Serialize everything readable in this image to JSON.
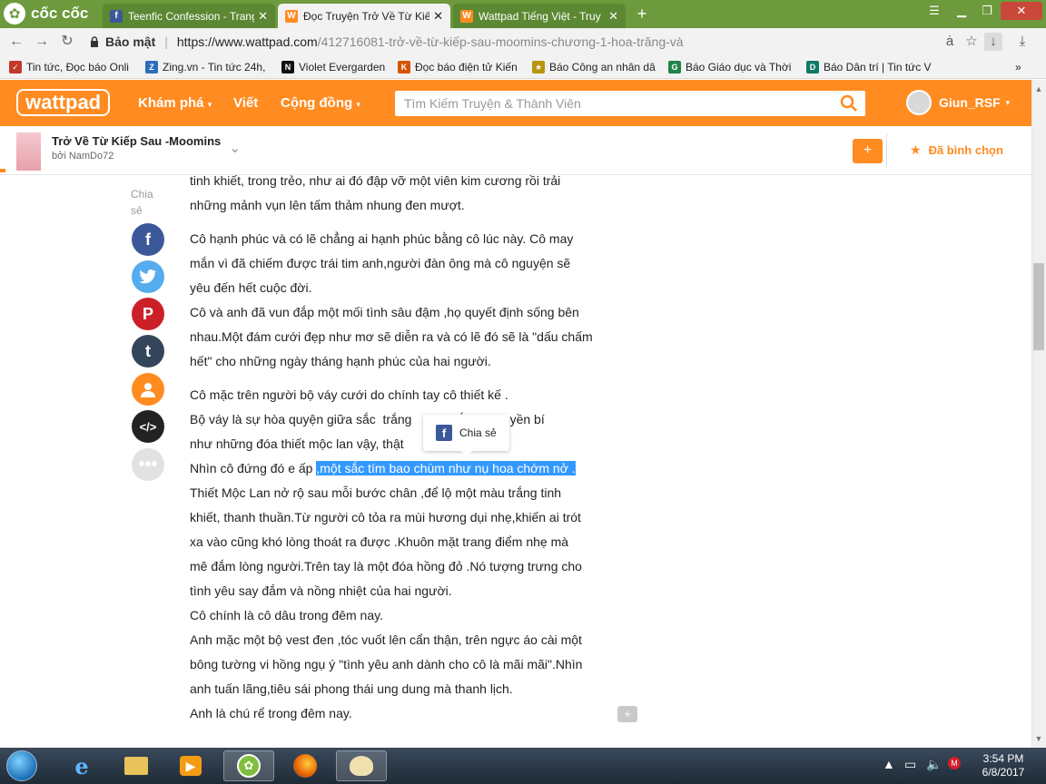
{
  "browser": {
    "brand": "cốc cốc",
    "tabs": [
      {
        "title": "Teenfic Confession - Trang",
        "active": false,
        "icon": "facebook-icon"
      },
      {
        "title": "Đọc Truyện Trở Về Từ Kiếp",
        "active": true,
        "icon": "wattpad-icon"
      },
      {
        "title": "Wattpad Tiếng Việt - Truy",
        "active": false,
        "icon": "wattpad-icon"
      }
    ],
    "address": {
      "secure_label": "Bảo mật",
      "domain": "https://www.wattpad.com",
      "path": "/412716081-trở-về-từ-kiếp-sau-moomins-chương-1-hoa-trăng-và"
    },
    "bookmarks": [
      {
        "label": "Tin tức, Đọc báo Onli",
        "icon": "news-check-icon"
      },
      {
        "label": "Zing.vn - Tin tức 24h,",
        "icon": "zing-icon"
      },
      {
        "label": "Violet Evergarden",
        "icon": "netflix-icon"
      },
      {
        "label": "Đọc báo điện tử Kiến",
        "icon": "kienthuc-icon"
      },
      {
        "label": "Báo Công an nhân dâ",
        "icon": "police-icon"
      },
      {
        "label": "Báo Giáo dục và Thời",
        "icon": "gd-icon"
      },
      {
        "label": "Báo Dân trí | Tin tức V",
        "icon": "dantri-icon"
      }
    ]
  },
  "wattpad": {
    "logo": "wattpad",
    "nav": {
      "explore": "Khám phá",
      "write": "Viết",
      "community": "Cộng đồng"
    },
    "search_placeholder": "Tìm Kiếm Truyện & Thành Viên",
    "username": "Giun_RSF",
    "story": {
      "title": "Trở Về Từ Kiếp Sau -Moomins",
      "author": "bởi NamDo72",
      "add_label": "+",
      "voted_label": "Đã bình chọn"
    },
    "share": {
      "label": "Chia sẻ",
      "popup_label": "Chia sẻ",
      "icons": [
        "facebook-icon",
        "twitter-icon",
        "pinterest-icon",
        "tumblr-icon",
        "user-icon",
        "embed-icon",
        "more-icon"
      ]
    },
    "paragraphs": [
      {
        "lines": [
          "tinh khiết, trong trẻo, như ai đó đập vỡ một viên kim cương rồi trải",
          "những mảnh vụn lên tấm thảm nhung đen mượt."
        ]
      },
      {
        "lines": [
          "Cô hạnh phúc và có lẽ chẳng ai hạnh phúc bằng cô lúc này. Cô may",
          "mắn vì đã chiếm được trái tim anh,người đàn ông mà cô nguyện sẽ",
          "yêu đến hết cuộc đời.",
          "Cô và anh đã vun đắp một mối tình sâu đậm ,họ quyết định sống bên",
          "nhau.Một đám cưới đẹp như mơ sẽ diễn ra và có lẽ đó sẽ là \"dấu chấm",
          "hết\" cho những ngày tháng hạnh phúc của hai người."
        ]
      },
      {
        "lines": [
          "Cô mặc trên người bộ váy cưới do chính tay cô thiết kế .",
          "Bộ váy là sự hòa quyện giữa sắc  trắng             ắc tím huyền bí",
          "như những đóa thiết mộc lan vậy, thật               ý phái."
        ]
      }
    ],
    "highlight_prefix": "Nhìn cô đứng đó e ấp ",
    "highlight_text": ",một sắc tím bao chùm như nụ hoa chớm nở .",
    "after_lines": [
      "Thiết Mộc Lan nở rộ sau mỗi bước chân ,để lộ một màu trắng tinh",
      "khiết, thanh thuần.Từ người cô tỏa ra mùi hương dụi nhẹ,khiến ai trót",
      "xa vào cũng khó lòng thoát ra được .Khuôn mặt trang điểm nhẹ mà",
      "mê đắm lòng người.Trên tay là một đóa hồng đỏ .Nó tượng trưng cho",
      "tình yêu say đắm và nồng nhiệt của hai người.",
      "Cô chính là cô dâu trong đêm nay.",
      "Anh mặc một bộ vest đen ,tóc vuốt lên cẩn thận, trên ngực áo cài một",
      "bông tường vi hồng ngụ ý \"tình yêu anh dành cho cô là mãi mãi\".Nhìn",
      "anh tuấn lãng,tiêu sái phong thái ung dung mà thanh lịch.",
      "Anh là chú rể trong đêm nay."
    ]
  },
  "taskbar": {
    "time": "3:54 PM",
    "date": "6/8/2017"
  },
  "colors": {
    "wattpad_orange": "#ff8b21",
    "coccoc_green": "#6c9a3c",
    "highlight": "#3399ff"
  }
}
